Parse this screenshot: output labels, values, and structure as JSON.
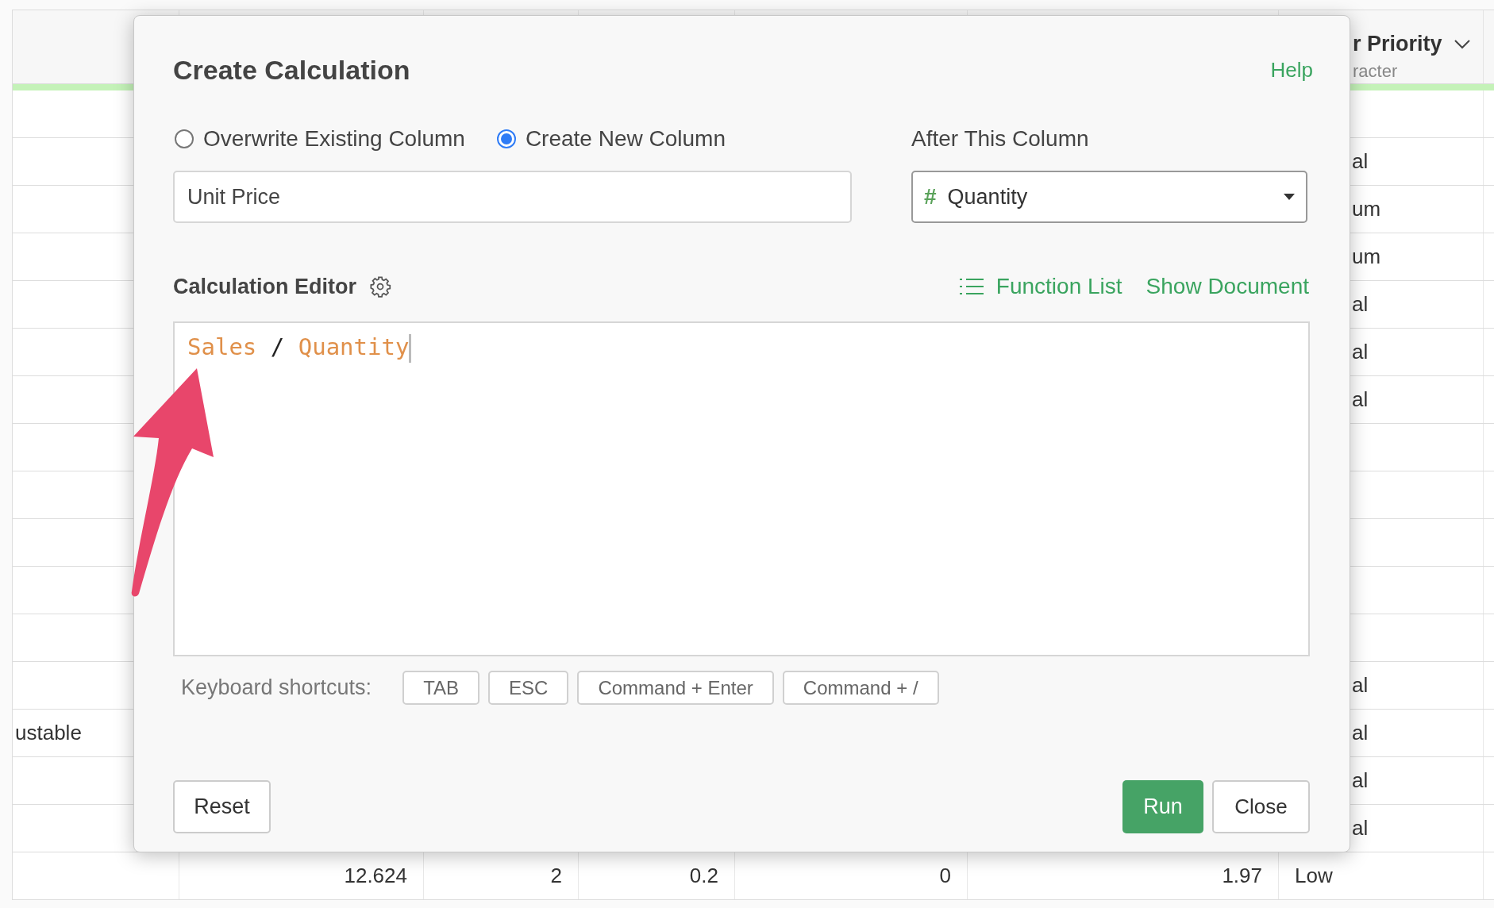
{
  "table": {
    "header": {
      "title": "r Priority",
      "subtitle": "racter"
    },
    "rows": [
      {},
      {
        "column_7": "al"
      },
      {
        "column_7": "um"
      },
      {
        "column_7": "um"
      },
      {
        "column_7": "al"
      },
      {
        "column_7": "al"
      },
      {
        "column_7": "al"
      },
      {},
      {},
      {},
      {},
      {},
      {
        "column_7": "al"
      },
      {
        "column_1": "ustable",
        "column_7": "al"
      },
      {
        "column_7": "al"
      },
      {
        "column_7": "al"
      },
      {
        "column_2": "12.624",
        "column_3": "2",
        "column_4": "0.2",
        "column_5": "0",
        "column_6": "1.97",
        "column_7": "Low"
      }
    ]
  },
  "dialog": {
    "title": "Create Calculation",
    "help_link": "Help",
    "options": [
      {
        "label": "Overwrite Existing Column",
        "selected": false
      },
      {
        "label": "Create New Column",
        "selected": true
      }
    ],
    "column_name": {
      "value": "Unit Price"
    },
    "after_column": {
      "label": "After This Column",
      "type_symbol": "#",
      "value": "Quantity"
    },
    "editor": {
      "label": "Calculation Editor",
      "links": [
        "Function List",
        "Show Document"
      ],
      "tokens": [
        {
          "text": "Sales",
          "kind": "column"
        },
        {
          "text": "/",
          "kind": "operator"
        },
        {
          "text": "Quantity",
          "kind": "column"
        }
      ]
    },
    "shortcuts": {
      "label": "Keyboard shortcuts:",
      "keys": [
        "TAB",
        "ESC",
        "Command + Enter",
        "Command + /"
      ]
    },
    "buttons": {
      "reset": "Reset",
      "run": "Run",
      "close": "Close"
    }
  }
}
